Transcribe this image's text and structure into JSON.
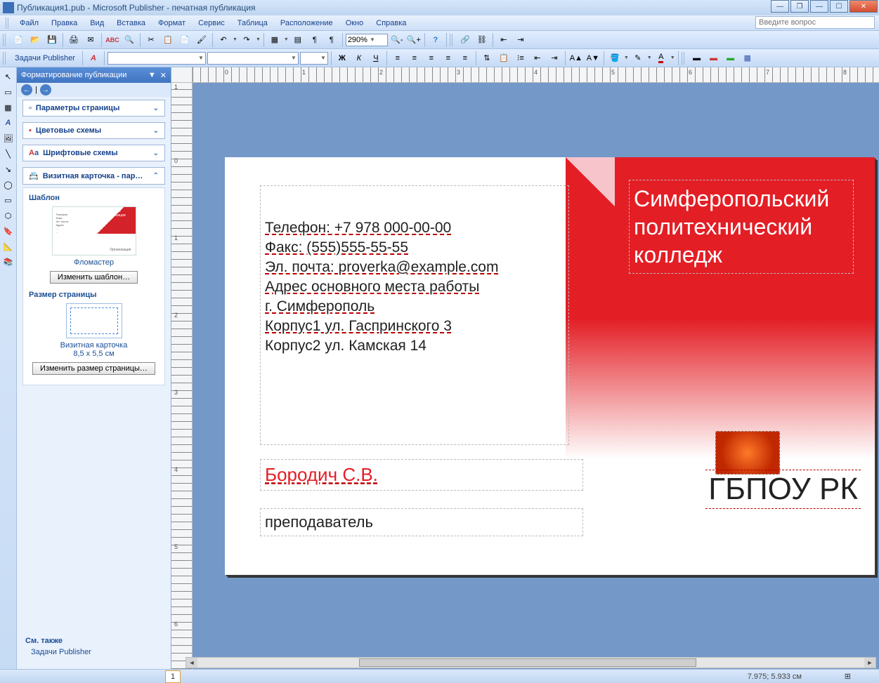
{
  "title": "Публикация1.pub - Microsoft Publisher - печатная публикация",
  "question_placeholder": "Введите вопрос",
  "menu": {
    "file": "Файл",
    "edit": "Правка",
    "view": "Вид",
    "insert": "Вставка",
    "format": "Формат",
    "tools": "Сервис",
    "table": "Таблица",
    "layout": "Расположение",
    "window": "Окно",
    "help": "Справка"
  },
  "toolbar": {
    "tasks_label": "Задачи Publisher",
    "zoom": "290%"
  },
  "taskpane": {
    "title": "Форматирование публикации",
    "sec_page": "Параметры страницы",
    "sec_color": "Цветовые схемы",
    "sec_font": "Шрифтовые схемы",
    "sec_biz": "Визитная карточка - пар…",
    "template_head": "Шаблон",
    "thumb_name": "Фломастер",
    "change_template": "Изменить шаблон…",
    "size_head": "Размер страницы",
    "size_name": "Визитная карточка",
    "size_dim": "8,5 x 5,5 см",
    "change_size": "Изменить размер страницы…",
    "see_also_head": "См. также",
    "see_also_link": "Задачи Publisher"
  },
  "card": {
    "phone": "Телефон: +7 978 000-00-00",
    "fax": "Факс: (555)555-55-55",
    "email": "Эл. почта: proverka@example.com",
    "addr_head": "Адрес основного места работы",
    "city": "г. Симферополь",
    "bldg1": "Корпус1 ул. Гаспринского 3",
    "bldg2": "Корпус2 ул. Камская 14",
    "name": "Бородич С.В.",
    "role": "преподаватель",
    "org_full_l1": "Симферопольский",
    "org_full_l2": "политехнический",
    "org_full_l3": "колледж",
    "org_short": "ГБПОУ РК"
  },
  "status": {
    "page_no": "1",
    "coords": "7.975; 5.933 см"
  },
  "thumb_text": {
    "org": "Название организации"
  }
}
